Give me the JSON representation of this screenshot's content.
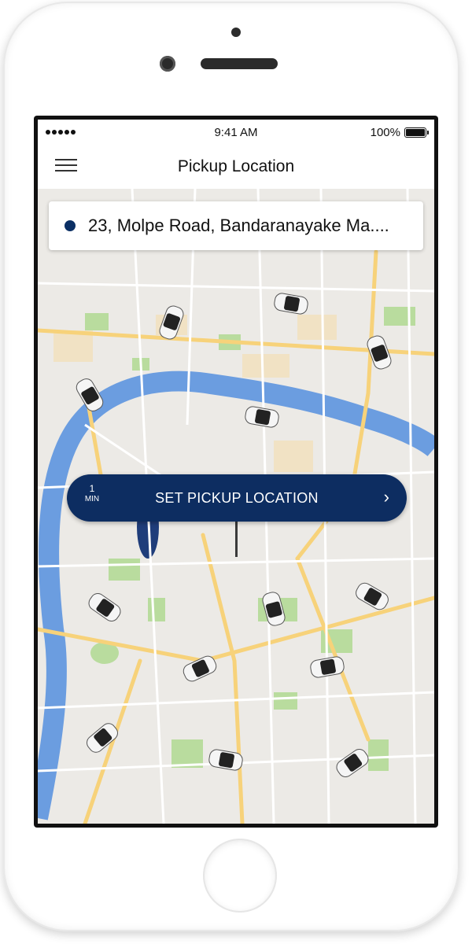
{
  "status_bar": {
    "time": "9:41 AM",
    "battery": "100%"
  },
  "nav": {
    "title": "Pickup Location",
    "menu_icon": "hamburger-menu-icon"
  },
  "address": {
    "text": "23, Molpe Road, Bandaranayake Ma...."
  },
  "pickup_button": {
    "eta_value": "1",
    "eta_unit": "MIN",
    "label": "SET PICKUP LOCATION",
    "chevron": "›"
  },
  "colors": {
    "brand_navy": "#0d2d61",
    "map_bg": "#eceae6",
    "river": "#6b9de0",
    "park": "#b9dc9e",
    "road_major": "#f7d27a"
  }
}
